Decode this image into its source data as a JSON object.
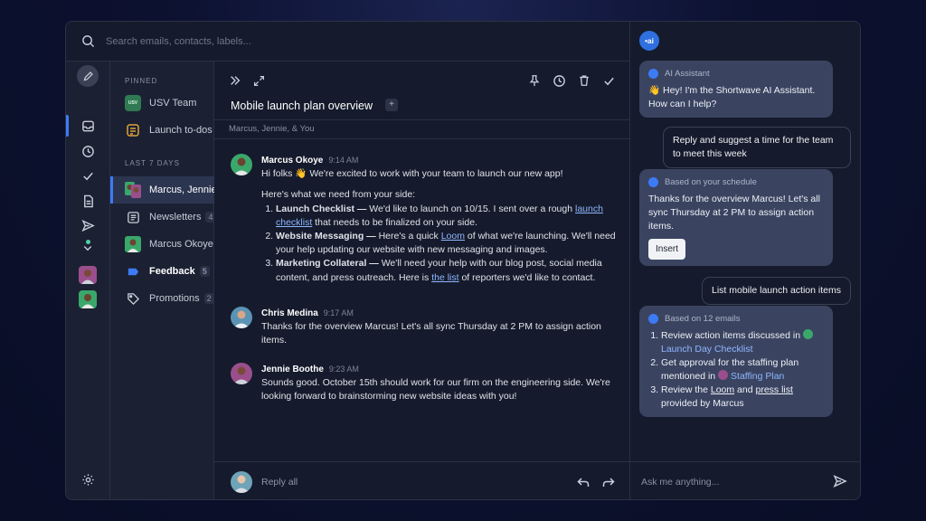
{
  "search": {
    "placeholder": "Search emails, contacts, labels..."
  },
  "sidebar": {
    "pinned_label": "PINNED",
    "pinned": [
      {
        "label": "USV Team",
        "badge": "USV"
      },
      {
        "label": "Launch to-dos"
      }
    ],
    "recent_label": "LAST 7 DAYS",
    "recent": [
      {
        "label": "Marcus, Jennie",
        "active": true
      },
      {
        "label": "Newsletters",
        "count": "4"
      },
      {
        "label": "Marcus Okoye"
      },
      {
        "label": "Feedback",
        "count": "5"
      },
      {
        "label": "Promotions",
        "count": "2"
      }
    ]
  },
  "thread": {
    "subject": "Mobile launch plan overview",
    "participants": "Marcus, Jennie, & You",
    "messages": [
      {
        "name": "Marcus Okoye",
        "time": "9:14 AM",
        "intro": "Hi folks 👋 We're excited to work with your team to launch our new app!",
        "need": "Here's what we need from your side:",
        "items": [
          {
            "title": "Launch Checklist —",
            "pre": " We'd like to launch on 10/15. I sent over a rough ",
            "link": "launch checklist",
            "post": " that needs to be finalized on your side."
          },
          {
            "title": "Website Messaging —",
            "pre": " Here's a quick ",
            "link": "Loom",
            "post": " of what we're launching. We'll need your help updating our website with new messaging and images."
          },
          {
            "title": "Marketing Collateral —",
            "pre": " We'll need your help with our blog post, social media content, and press outreach. Here is ",
            "link": "the list",
            "post": " of reporters we'd like to contact."
          }
        ]
      },
      {
        "name": "Chris Medina",
        "time": "9:17 AM",
        "text": "Thanks for the overview Marcus! Let's all sync Thursday at 2 PM to assign action items."
      },
      {
        "name": "Jennie Boothe",
        "time": "9:23 AM",
        "text": "Sounds good. October 15th should work for our firm on the engineering side. We're looking forward to brainstorming new website ideas with you!"
      }
    ],
    "reply_placeholder": "Reply all"
  },
  "ai": {
    "logo": "•ai",
    "greeting_head": "AI Assistant",
    "greeting": "👋 Hey! I'm the Shortwave AI Assistant. How can I help?",
    "user_1": "Reply and suggest a time for the team to meet this week",
    "schedule_head": "Based on your schedule",
    "schedule_text": "Thanks for the overview Marcus! Let's all sync Thursday at 2 PM to assign action items.",
    "insert_label": "Insert",
    "user_2": "List mobile launch action items",
    "emails_head": "Based on 12 emails",
    "list": {
      "i1": "Review action items discussed in",
      "i1_chip": "Launch Day Checklist",
      "i2": "Get approval for the staffing plan mentioned in",
      "i2_chip": "Staffing Plan",
      "i3_a": "Review the ",
      "i3_link1": "Loom",
      "i3_b": " and ",
      "i3_link2": "press list",
      "i3_c": " provided by Marcus"
    },
    "input_placeholder": "Ask me anything..."
  },
  "colors": {
    "accent": "#3d7bf5",
    "link": "#8fb6ff",
    "online": "#4fd1a5"
  },
  "icons": [
    "search-icon",
    "pencil-icon",
    "inbox-icon",
    "clock-icon",
    "check-icon",
    "document-icon",
    "send-icon",
    "chevron-down-icon",
    "settings-icon",
    "expand-icon",
    "fullscreen-icon",
    "pin-icon",
    "trash-icon",
    "reply-icon",
    "forward-icon"
  ]
}
